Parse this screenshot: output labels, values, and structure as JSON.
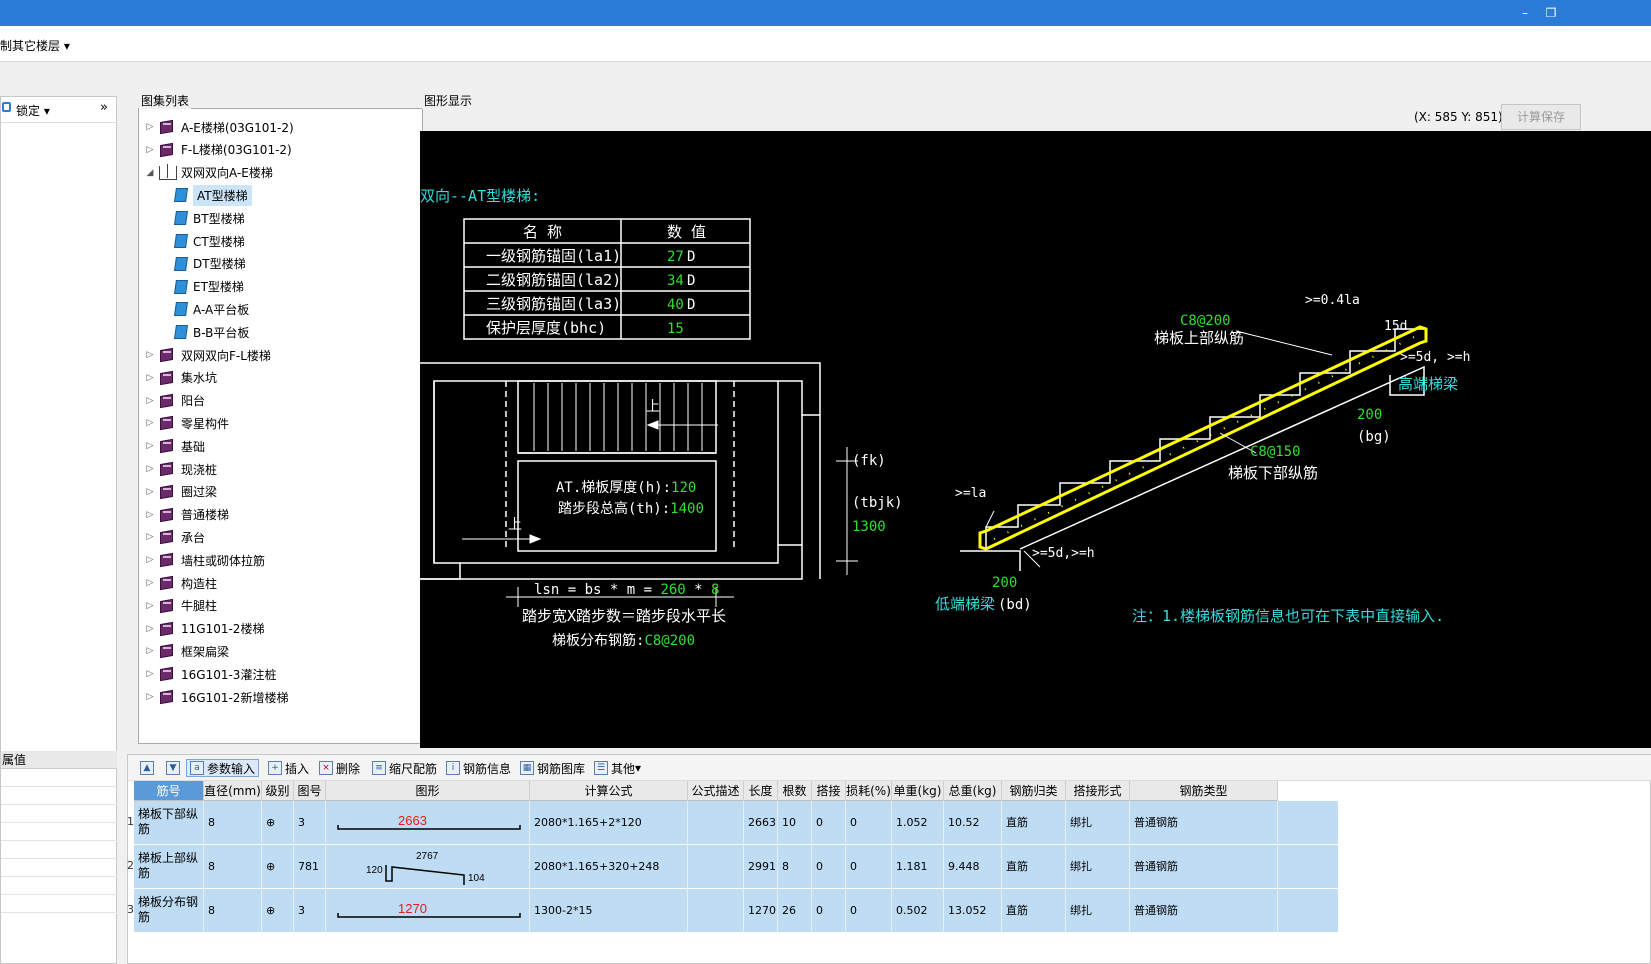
{
  "window": {
    "min_icon": "minimize-icon",
    "restore_icon": "restore-icon",
    "min_glyph": "–",
    "restore_glyph": "❐"
  },
  "menu": {
    "item": "制其它楼层",
    "dropdown_glyph": "▾"
  },
  "left": {
    "lock_label": "锁定",
    "expand_glyph": "»",
    "attr_header": "属值"
  },
  "atlas": {
    "group_label": "图集列表",
    "items": [
      {
        "label": "A-E楼梯(03G101-2)",
        "level": 0,
        "type": "book",
        "arrow": "▷"
      },
      {
        "label": "F-L楼梯(03G101-2)",
        "level": 0,
        "type": "book",
        "arrow": "▷"
      },
      {
        "label": "双网双向A-E楼梯",
        "level": 0,
        "type": "openbook",
        "arrow": "◢"
      },
      {
        "label": "AT型楼梯",
        "level": 1,
        "type": "page",
        "selected": true
      },
      {
        "label": "BT型楼梯",
        "level": 1,
        "type": "page"
      },
      {
        "label": "CT型楼梯",
        "level": 1,
        "type": "page"
      },
      {
        "label": "DT型楼梯",
        "level": 1,
        "type": "page"
      },
      {
        "label": "ET型楼梯",
        "level": 1,
        "type": "page"
      },
      {
        "label": "A-A平台板",
        "level": 1,
        "type": "page"
      },
      {
        "label": "B-B平台板",
        "level": 1,
        "type": "page"
      },
      {
        "label": "双网双向F-L楼梯",
        "level": 0,
        "type": "book",
        "arrow": "▷"
      },
      {
        "label": "集水坑",
        "level": 0,
        "type": "book",
        "arrow": "▷"
      },
      {
        "label": "阳台",
        "level": 0,
        "type": "book",
        "arrow": "▷"
      },
      {
        "label": "零星构件",
        "level": 0,
        "type": "book",
        "arrow": "▷"
      },
      {
        "label": "基础",
        "level": 0,
        "type": "book",
        "arrow": "▷"
      },
      {
        "label": "现浇桩",
        "level": 0,
        "type": "book",
        "arrow": "▷"
      },
      {
        "label": "圈过梁",
        "level": 0,
        "type": "book",
        "arrow": "▷"
      },
      {
        "label": "普通楼梯",
        "level": 0,
        "type": "book",
        "arrow": "▷"
      },
      {
        "label": "承台",
        "level": 0,
        "type": "book",
        "arrow": "▷"
      },
      {
        "label": "墙柱或砌体拉筋",
        "level": 0,
        "type": "book",
        "arrow": "▷"
      },
      {
        "label": "构造柱",
        "level": 0,
        "type": "book",
        "arrow": "▷"
      },
      {
        "label": "牛腿柱",
        "level": 0,
        "type": "book",
        "arrow": "▷"
      },
      {
        "label": "11G101-2楼梯",
        "level": 0,
        "type": "book",
        "arrow": "▷"
      },
      {
        "label": "框架扁梁",
        "level": 0,
        "type": "book",
        "arrow": "▷"
      },
      {
        "label": "16G101-3灌注桩",
        "level": 0,
        "type": "book",
        "arrow": "▷"
      },
      {
        "label": "16G101-2新增楼梯",
        "level": 0,
        "type": "book",
        "arrow": "▷"
      }
    ]
  },
  "graph": {
    "group_label": "图形显示",
    "coords": "(X: 585 Y: 851)",
    "calc_save": "计算保存",
    "drawing": {
      "title": "双向--AT型楼梯:",
      "table_header_name": "名  称",
      "table_header_value": "数  值",
      "params": [
        {
          "name": "一级钢筋锚固(la1)",
          "value": "27",
          "unit": "D"
        },
        {
          "name": "二级钢筋锚固(la2)",
          "value": "34",
          "unit": "D"
        },
        {
          "name": "三级钢筋锚固(la3)",
          "value": "40",
          "unit": "D"
        },
        {
          "name": "保护层厚度(bhc)",
          "value": "15",
          "unit": ""
        }
      ],
      "up_label": "上",
      "thickness_label": "AT.梯板厚度(h):",
      "thickness_value": "120",
      "height_label": "踏步段总高(th):",
      "height_value": "1400",
      "fk_label": "(fk)",
      "tbjk_label": "(tbjk)",
      "tbjk_value": "1300",
      "lsn_prefix": "lsn = bs * m = ",
      "lsn_bs": "260",
      "lsn_star": " * ",
      "lsn_m": "8",
      "formula_text": "踏步宽X踏步数＝踏步段水平长",
      "dist_label": "梯板分布钢筋:",
      "dist_value": "C8@200",
      "top_bar_spec": "C8@200",
      "top_bar_label": "梯板上部纵筋",
      "bottom_bar_spec": "C8@150",
      "bottom_bar_label": "梯板下部纵筋",
      "anchor_top": ">=0.4la",
      "anchor_15d": "15d",
      "anchor_5d_h_right": ">=5d, >=h",
      "high_beam": "高端梯梁",
      "bg_value": "200",
      "bg_label": "(bg)",
      "la_label": ">=la",
      "anchor_5d_h_left": ">=5d,>=h",
      "bd_value": "200",
      "low_beam": "低端梯梁",
      "bd_label": "(bd)",
      "note": "注：1.楼梯板钢筋信息也可在下表中直接输入."
    }
  },
  "toolbar": {
    "param_input": "参数输入",
    "insert": "插入",
    "delete": "删除",
    "scale_rebar": "缩尺配筋",
    "rebar_info": "钢筋信息",
    "rebar_library": "钢筋图库",
    "other": "其他"
  },
  "grid": {
    "columns": [
      "筋号",
      "直径(mm)",
      "级别",
      "图号",
      "图形",
      "计算公式",
      "公式描述",
      "长度",
      "根数",
      "搭接",
      "损耗(%)",
      "单重(kg)",
      "总重(kg)",
      "钢筋归类",
      "搭接形式",
      "钢筋类型"
    ],
    "rows": [
      {
        "no": "1",
        "name": "梯板下部纵筋",
        "dia": "8",
        "grade": "⊕",
        "fig": "3",
        "shape_main": "2663",
        "shape_type": "straight",
        "formula": "2080*1.165+2*120",
        "desc": "",
        "length": "2663",
        "count": "10",
        "lap": "0",
        "loss": "0",
        "unit_w": "1.052",
        "total_w": "10.52",
        "category": "直筋",
        "lap_type": "绑扎",
        "rebar_type": "普通钢筋"
      },
      {
        "no": "2",
        "name": "梯板上部纵筋",
        "dia": "8",
        "grade": "⊕",
        "fig": "781",
        "shape_main": "2767",
        "shape_left": "120",
        "shape_right": "104",
        "shape_type": "bent",
        "formula": "2080*1.165+320+248",
        "desc": "",
        "length": "2991",
        "count": "8",
        "lap": "0",
        "loss": "0",
        "unit_w": "1.181",
        "total_w": "9.448",
        "category": "直筋",
        "lap_type": "绑扎",
        "rebar_type": "普通钢筋"
      },
      {
        "no": "3",
        "name": "梯板分布钢筋",
        "dia": "8",
        "grade": "⊕",
        "fig": "3",
        "shape_main": "1270",
        "shape_type": "straight",
        "formula": "1300-2*15",
        "desc": "",
        "length": "1270",
        "count": "26",
        "lap": "0",
        "loss": "0",
        "unit_w": "0.502",
        "total_w": "13.052",
        "category": "直筋",
        "lap_type": "绑扎",
        "rebar_type": "普通钢筋"
      }
    ]
  },
  "colors": {
    "titlebar": "#2b7bd8",
    "canvas": "#000000",
    "cad_text": "#ffffff",
    "cad_value": "#33dd33",
    "cad_accent": "#33dddd",
    "cad_rebar": "#ffff00",
    "shape_label": "#e0201f",
    "row_bg": "#bfdcf5"
  }
}
